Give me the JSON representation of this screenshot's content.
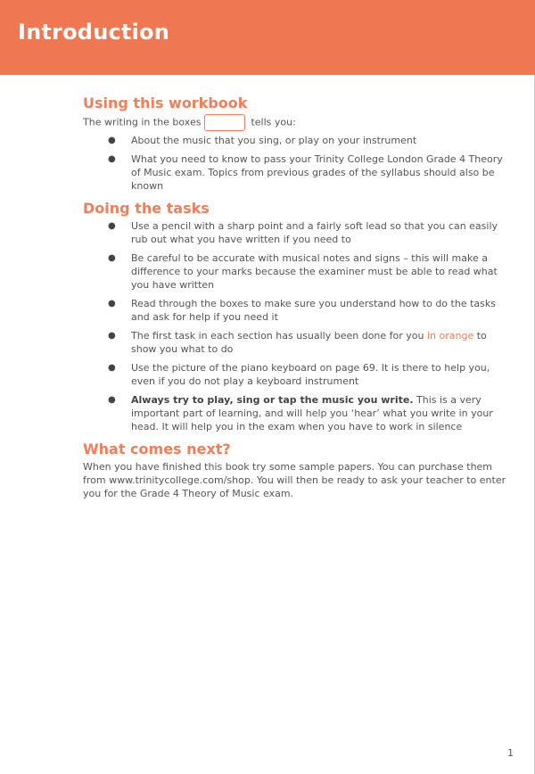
{
  "header": {
    "title": "Introduction",
    "color": "#ef7751"
  },
  "sections": {
    "using": {
      "heading": "Using this workbook",
      "intro_before": "The writing in the boxes",
      "intro_after": "tells you:",
      "bullets": [
        "About the music that you sing, or play on your instrument",
        "What you need to know to pass your Trinity College London Grade 4 Theory of Music exam. Topics from previous grades of the syllabus should also be known"
      ]
    },
    "doing": {
      "heading": "Doing the tasks",
      "bullets": [
        "Use a pencil with a sharp point and a fairly soft lead so that you can easily rub out what you have written if you need to",
        "Be careful to be accurate with musical notes and signs – this will make a difference to your marks because the examiner must be able to read what you have written",
        "Read through the boxes to make sure you understand how to do the tasks and ask for help if you need it"
      ],
      "orange_bullet": {
        "before": "The first task in each section has usually been done for you ",
        "highlight": "in orange",
        "after": " to show you what to do"
      },
      "keyboard_bullet": "Use the picture of the piano keyboard on page 69. It is there to help you, even if you do not play a keyboard instrument",
      "play_bullet": {
        "bold": "Always try to play, sing or tap the music you write.",
        "rest": " This is a very important part of learning, and will help you ‘hear’ what you write in your head. It will help you in the exam when you have to work in silence"
      }
    },
    "next": {
      "heading": "What comes next?",
      "body": "When you have finished this book try some sample papers. You can purchase them from www.trinitycollege.com/shop. You will then be ready to ask your teacher to enter you for the Grade 4 Theory of Music exam."
    }
  },
  "footer": {
    "page_number": "1"
  }
}
